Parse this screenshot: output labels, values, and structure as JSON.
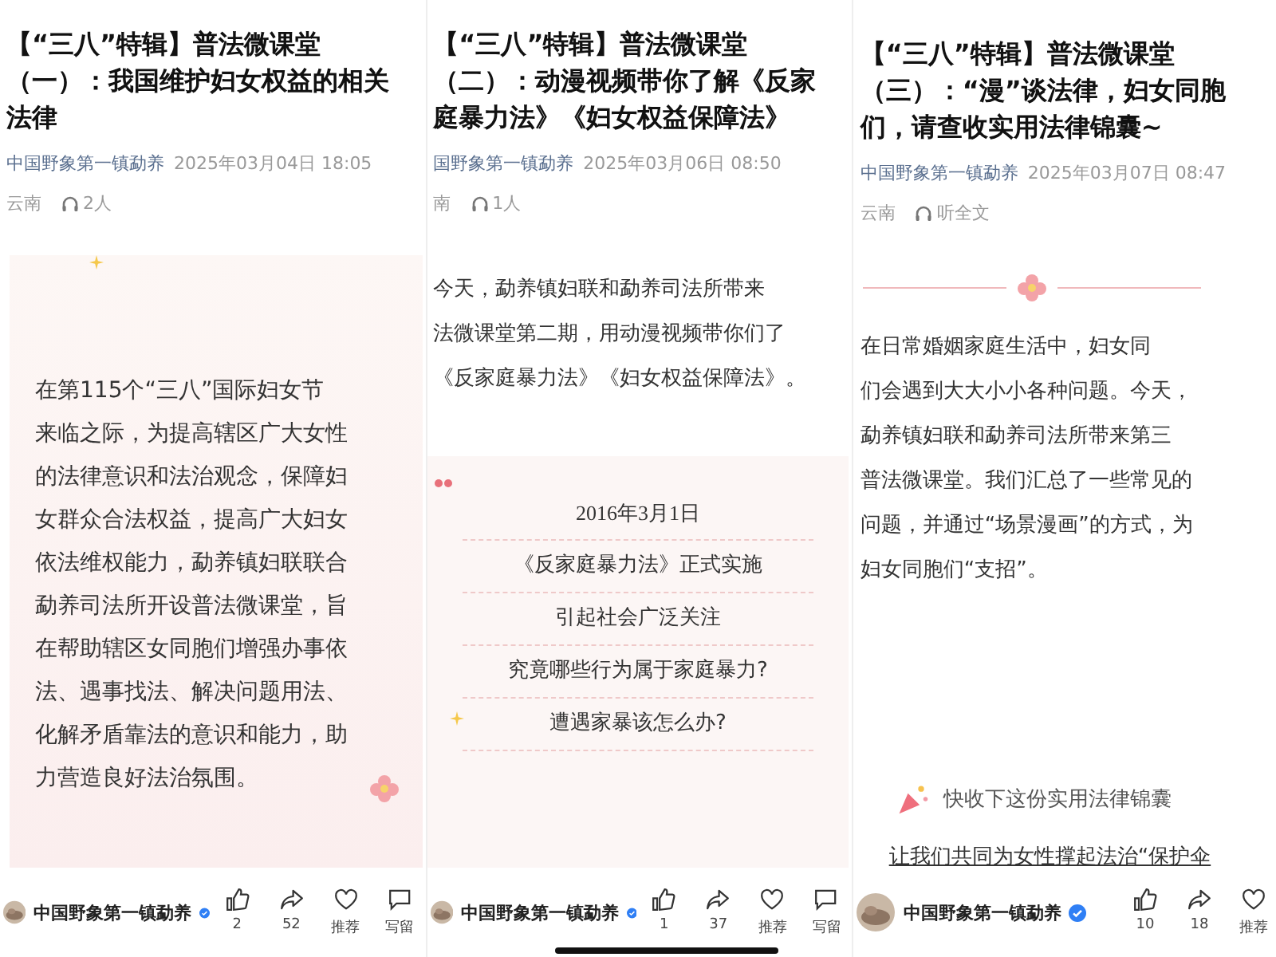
{
  "panels": [
    {
      "title_lines": [
        "【“三八”特辑】普法微课堂",
        "（一）：我国维护妇女权益的相关",
        "法律"
      ],
      "author": "中国野象第一镇勐养",
      "date": "2025年03月04日 18:05",
      "location": "云南",
      "listen": "2人",
      "body": [
        {
          "kind": "card",
          "lines": [
            "在第115个“三八”国际妇女节",
            "来临之际，为提高辖区广大女性",
            "的法律意识和法治观念，保障妇",
            "女群众合法权益，提高广大妇女",
            "依法维权能力，勐养镇妇联联合",
            "勐养司法所开设普法微课堂，旨",
            "在帮助辖区女同胞们增强办事依",
            "法、遇事找法、解决问题用法、",
            "化解矛盾靠法的意识和能力，助",
            "力营造良好法治氛围。"
          ]
        }
      ],
      "footer": {
        "account": "中国野象第一镇勐养",
        "likes": "2",
        "shares": "52",
        "recommend": "推荐",
        "comment": "写留"
      }
    },
    {
      "title_lines": [
        "【“三八”特辑】普法微课堂",
        "（二）：动漫视频带你了解《反家",
        "庭暴力法》《妇女权益保障法》"
      ],
      "author": "国野象第一镇勐养",
      "date": "2025年03月06日 08:50",
      "location": "南",
      "listen": "1人",
      "body": [
        {
          "kind": "paragraph",
          "lines": [
            "今天，勐养镇妇联和勐养司法所带来",
            "法微课堂第二期，用动漫视频带你们了",
            "《反家庭暴力法》《妇女权益保障法》。"
          ]
        },
        {
          "kind": "quote_list",
          "lines": [
            "2016年3月1日",
            "《反家庭暴力法》正式实施",
            "引起社会广泛关注",
            "究竟哪些行为属于家庭暴力?",
            "遭遇家暴该怎么办?"
          ]
        }
      ],
      "footer": {
        "account": "中国野象第一镇勐养",
        "likes": "1",
        "shares": "37",
        "recommend": "推荐",
        "comment": "写留"
      }
    },
    {
      "title_lines": [
        "【“三八”特辑】普法微课堂",
        "（三）：“漫”谈法律，妇女同胞",
        "们，请查收实用法律锦囊~"
      ],
      "author": "中国野象第一镇勐养",
      "date": "2025年03月07日 08:47",
      "location": "云南",
      "listen": "听全文",
      "body": [
        {
          "kind": "flower_divider"
        },
        {
          "kind": "paragraph",
          "lines": [
            "在日常婚姻家庭生活中，妇女同",
            "们会遇到大大小小各种问题。今天，",
            "勐养镇妇联和勐养司法所带来第三",
            "普法微课堂。我们汇总了一些常见的",
            "问题，并通过“场景漫画”的方式，为",
            "妇女同胞们“支招”。"
          ]
        },
        {
          "kind": "banner",
          "text": "快收下这份实用法律锦囊"
        },
        {
          "kind": "underlined",
          "text": "让我们共同为女性撑起法治“保护伞"
        }
      ],
      "footer": {
        "account": "中国野象第一镇勐养",
        "likes": "10",
        "shares": "18",
        "recommend": "推荐"
      }
    }
  ]
}
